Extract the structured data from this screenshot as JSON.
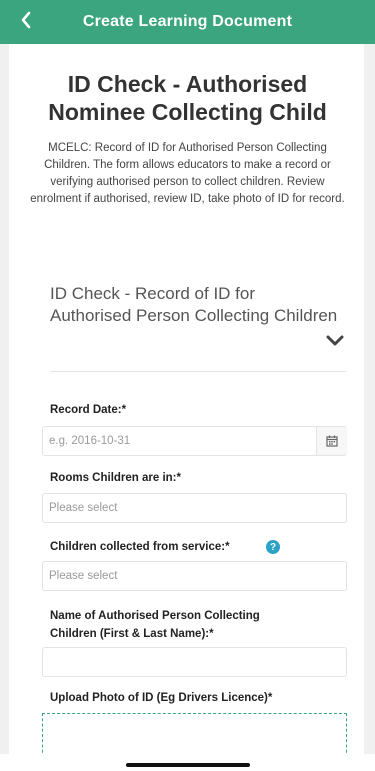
{
  "header": {
    "title": "Create Learning Document"
  },
  "form": {
    "title_line1": "ID Check - Authorised",
    "title_line2": "Nominee Collecting Child",
    "description": "MCELC: Record of ID for Authorised Person Collecting Children. The form allows educators to make a record or verifying authorised person to collect children. Review enrolment if authorised, review ID, take photo of ID for record."
  },
  "section": {
    "title": "ID Check - Record of ID for Authorised Person Collecting Children"
  },
  "fields": {
    "record_date": {
      "label": "Record Date:",
      "required": "*",
      "placeholder": "e.g. 2016-10-31"
    },
    "rooms": {
      "label": "Rooms Children are in:",
      "required": "*",
      "placeholder": "Please select"
    },
    "collected_from": {
      "label": "Children collected from service:",
      "required": "*",
      "placeholder": "Please select"
    },
    "authorised_name": {
      "label_line1": "Name of Authorised Person Collecting",
      "label_line2": "Children (First & Last Name):",
      "required": "*",
      "value": ""
    },
    "upload_photo": {
      "label": "Upload Photo of ID (Eg Drivers Licence)",
      "required": "*"
    }
  },
  "colors": {
    "brand": "#3aa57f",
    "help": "#2ba2c7"
  },
  "icons": [
    "chevron-left-icon",
    "chevron-down-icon",
    "calendar-icon",
    "help-icon"
  ]
}
